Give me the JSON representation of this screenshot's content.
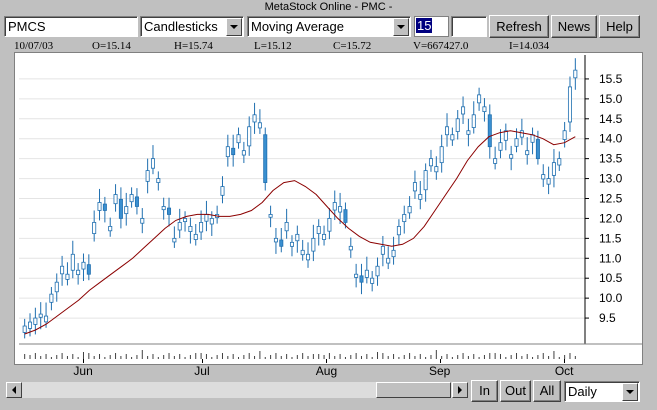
{
  "window": {
    "title": "MetaStock Online - PMC -"
  },
  "toolbar": {
    "symbol": "PMCS",
    "chart_style": "Candlesticks",
    "indicator": "Moving Average",
    "period": "15",
    "blank": "",
    "refresh_label": "Refresh",
    "news_label": "News",
    "help_label": "Help"
  },
  "info_bar": {
    "date": "10/07/03",
    "open": "O=15.14",
    "high": "H=15.74",
    "low": "L=15.12",
    "close": "C=15.72",
    "volume": "V=667427.0",
    "indicator": "I=14.034"
  },
  "chart_data": {
    "type": "candlestick",
    "y_ticks": [
      "15.5",
      "15.0",
      "14.5",
      "14.0",
      "13.5",
      "13.0",
      "12.5",
      "12.0",
      "11.5",
      "11.0",
      "10.5",
      "10.0",
      "9.5"
    ],
    "ylim": [
      9.0,
      16.0
    ],
    "x_labels": [
      "Jun",
      "Jul",
      "Aug",
      "Sep",
      "Oct"
    ],
    "up_color": "#ffffff",
    "down_color": "#3a8fd0",
    "ma_color": "#8b0000",
    "closes": [
      9.3,
      9.4,
      9.5,
      9.6,
      9.55,
      10.1,
      10.4,
      10.8,
      10.6,
      11.1,
      10.7,
      10.9,
      10.6,
      11.9,
      12.4,
      12.2,
      11.8,
      12.6,
      12.0,
      12.3,
      12.6,
      12.3,
      12.0,
      13.2,
      13.5,
      13.0,
      12.3,
      12.1,
      11.5,
      11.9,
      12.0,
      11.8,
      11.6,
      11.9,
      12.1,
      12.0,
      12.1,
      12.8,
      13.8,
      13.6,
      14.1,
      13.7,
      14.3,
      14.6,
      14.4,
      12.9,
      12.1,
      11.5,
      11.3,
      11.9,
      11.4,
      11.6,
      11.2,
      11.1,
      11.5,
      11.8,
      11.6,
      12.0,
      12.4,
      12.3,
      11.9,
      11.3,
      10.6,
      10.4,
      10.7,
      10.5,
      10.8,
      11.3,
      11.0,
      11.2,
      11.8,
      12.1,
      12.3,
      12.9,
      12.6,
      13.2,
      13.5,
      13.3,
      13.8,
      14.3,
      14.1,
      14.5,
      14.8,
      14.2,
      14.6,
      15.1,
      14.8,
      13.8,
      13.5,
      13.9,
      14.2,
      13.6,
      14.0,
      14.2,
      13.7,
      14.1,
      13.5,
      13.1,
      13.0,
      13.4,
      13.5,
      14.2,
      15.3,
      15.72
    ],
    "moving_average": {
      "period": 15,
      "values": [
        9.1,
        9.2,
        9.35,
        9.55,
        9.75,
        9.95,
        10.2,
        10.4,
        10.6,
        10.8,
        11.0,
        11.25,
        11.5,
        11.75,
        11.95,
        12.05,
        12.1,
        12.1,
        12.05,
        12.05,
        12.1,
        12.2,
        12.4,
        12.7,
        12.9,
        12.95,
        12.8,
        12.6,
        12.3,
        12.0,
        11.75,
        11.55,
        11.4,
        11.35,
        11.3,
        11.35,
        11.5,
        11.8,
        12.2,
        12.6,
        13.0,
        13.45,
        13.8,
        14.05,
        14.15,
        14.2,
        14.15,
        14.1,
        14.0,
        13.85,
        13.9,
        14.05
      ]
    },
    "volume_bars": 104
  },
  "nav": {
    "in_label": "In",
    "out_label": "Out",
    "all_label": "All",
    "period_select": "Daily"
  },
  "colors": {
    "window_bg": "#c0c0c0",
    "selection": "#000080"
  }
}
